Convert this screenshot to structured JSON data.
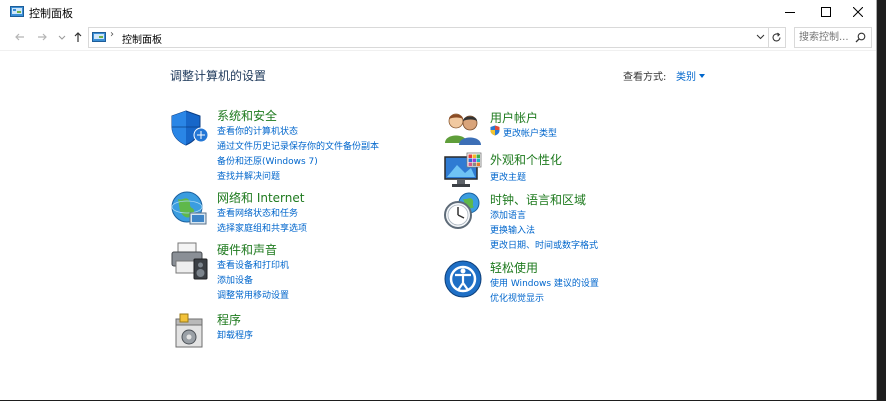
{
  "window": {
    "title": "控制面板"
  },
  "address": {
    "path": "控制面板",
    "search_placeholder": "搜索控制..."
  },
  "content": {
    "heading": "调整计算机的设置",
    "view_by_label": "查看方式:",
    "view_by_value": "类别"
  },
  "left_categories": [
    {
      "title": "系统和安全",
      "icon": "shield-icon",
      "links": [
        "查看你的计算机状态",
        "通过文件历史记录保存你的文件备份副本",
        "备份和还原(Windows 7)",
        "查找并解决问题"
      ]
    },
    {
      "title": "网络和 Internet",
      "icon": "network-globe-icon",
      "links": [
        "查看网络状态和任务",
        "选择家庭组和共享选项"
      ]
    },
    {
      "title": "硬件和声音",
      "icon": "printer-speaker-icon",
      "links": [
        "查看设备和打印机",
        "添加设备",
        "调整常用移动设置"
      ]
    },
    {
      "title": "程序",
      "icon": "programs-icon",
      "links": [
        "卸载程序"
      ]
    }
  ],
  "right_categories": [
    {
      "title": "用户帐户",
      "icon": "users-icon",
      "links": [
        "更改帐户类型"
      ]
    },
    {
      "title": "外观和个性化",
      "icon": "monitor-palette-icon",
      "links": [
        "更改主题"
      ]
    },
    {
      "title": "时钟、语言和区域",
      "icon": "clock-globe-icon",
      "links": [
        "添加语言",
        "更换输入法",
        "更改日期、时间或数字格式"
      ]
    },
    {
      "title": "轻松使用",
      "icon": "ease-of-access-icon",
      "links": [
        "使用 Windows 建议的设置",
        "优化视觉显示"
      ]
    }
  ],
  "colors": {
    "category_title": "#1e7a1e",
    "link": "#0066cc",
    "heading": "#1e395b"
  }
}
